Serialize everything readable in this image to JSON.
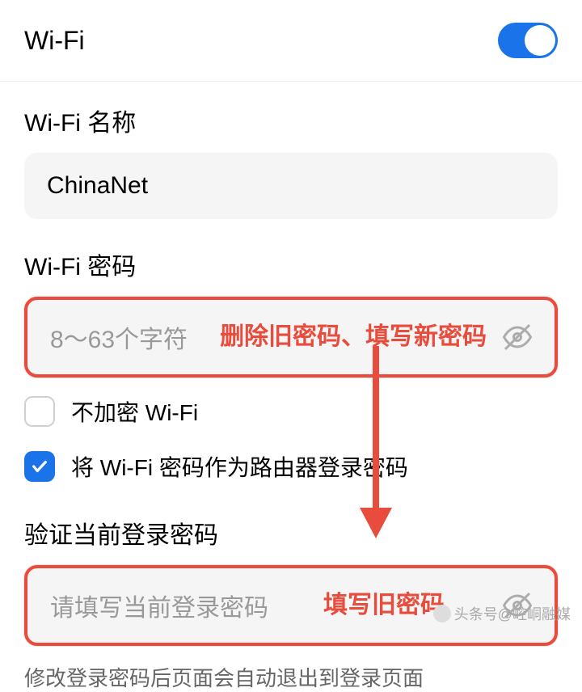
{
  "header": {
    "title": "Wi-Fi"
  },
  "wifiName": {
    "label": "Wi-Fi 名称",
    "value": "ChinaNet"
  },
  "wifiPassword": {
    "label": "Wi-Fi 密码",
    "placeholder": "8～63个字符",
    "annotation": "删除旧密码、填写新密码"
  },
  "noEncrypt": {
    "label": "不加密 Wi-Fi"
  },
  "useAsRouter": {
    "label": "将 Wi-Fi 密码作为路由器登录密码"
  },
  "verifyPassword": {
    "label": "验证当前登录密码",
    "placeholder": "请填写当前登录密码",
    "annotation": "填写旧密码"
  },
  "footer": {
    "note": "修改登录密码后页面会自动退出到登录页面"
  },
  "watermark": {
    "text": "头条号@崆峒融媒"
  }
}
